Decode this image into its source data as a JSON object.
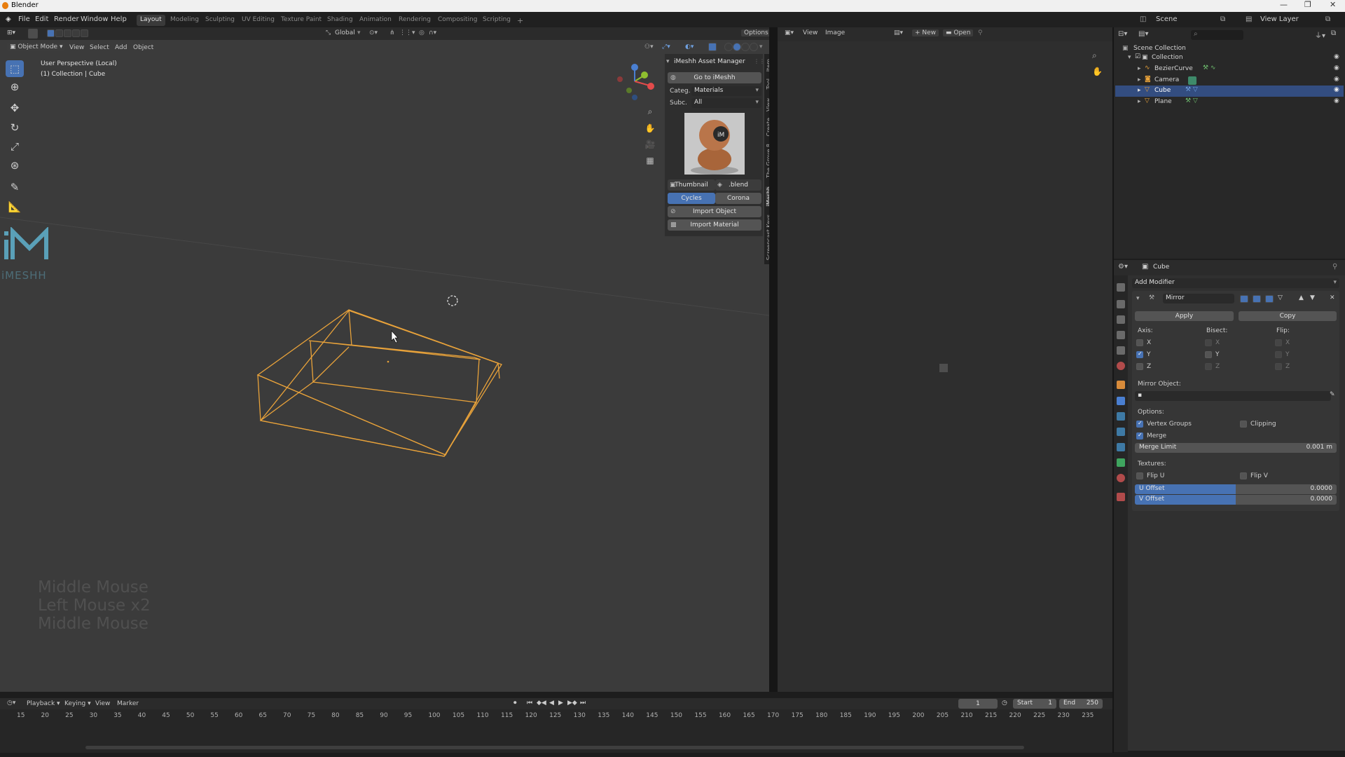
{
  "window": {
    "title": "Blender"
  },
  "menu": {
    "items": [
      "File",
      "Edit",
      "Render",
      "Window",
      "Help"
    ]
  },
  "workspaces": {
    "tabs": [
      "Layout",
      "Modeling",
      "Sculpting",
      "UV Editing",
      "Texture Paint",
      "Shading",
      "Animation",
      "Rendering",
      "Compositing",
      "Scripting"
    ],
    "active": "Layout",
    "add": "+"
  },
  "topright": {
    "scene": "Scene",
    "view_layer": "View Layer"
  },
  "viewport": {
    "mode": "Object Mode",
    "menus": [
      "View",
      "Select",
      "Add",
      "Object"
    ],
    "transform_orientation": "Global",
    "options_label": "Options",
    "overlay_line1": "User Perspective (Local)",
    "overlay_line2": "(1) Collection | Cube",
    "logo_text": "iMESHH",
    "screencast_keys": [
      "Middle Mouse",
      "Left Mouse x2",
      "Middle Mouse"
    ]
  },
  "npanel": {
    "title": "iMeshh Asset Manager",
    "goto_label": "Go to iMeshh",
    "category_label": "Categ.",
    "category_value": "Materials",
    "subcategory_label": "Subc.",
    "subcategory_value": "All",
    "thumbnail_label": "Thumbnail",
    "blend_label": ".blend",
    "render_engines": [
      "Cycles",
      "Corona"
    ],
    "active_engine": "Cycles",
    "import_object_label": "Import Object",
    "import_material_label": "Import Material",
    "side_tabs": [
      "Item",
      "Tool",
      "View",
      "Create",
      "The Grove 8",
      "iMeshh",
      "Screencast Keys"
    ]
  },
  "image_editor": {
    "menus": [
      "View",
      "Image"
    ],
    "new_label": "New",
    "open_label": "Open"
  },
  "outliner": {
    "root": "Scene Collection",
    "items": [
      {
        "label": "Collection",
        "level": 1,
        "selected": false
      },
      {
        "label": "BezierCurve",
        "level": 2,
        "selected": false
      },
      {
        "label": "Camera",
        "level": 2,
        "selected": false
      },
      {
        "label": "Cube",
        "level": 2,
        "selected": true
      },
      {
        "label": "Plane",
        "level": 2,
        "selected": false
      }
    ]
  },
  "properties": {
    "object_name": "Cube",
    "add_modifier_label": "Add Modifier",
    "modifier_name": "Mirror",
    "apply_label": "Apply",
    "copy_label": "Copy",
    "axis_label": "Axis:",
    "bisect_label": "Bisect:",
    "flip_label": "Flip:",
    "axes": [
      "X",
      "Y",
      "Z"
    ],
    "axis_checked": [
      false,
      true,
      false
    ],
    "mirror_object_label": "Mirror Object:",
    "options_label": "Options:",
    "vertex_groups_label": "Vertex Groups",
    "vertex_groups_checked": true,
    "clipping_label": "Clipping",
    "clipping_checked": false,
    "merge_label": "Merge",
    "merge_checked": true,
    "merge_limit_label": "Merge Limit",
    "merge_limit_value": "0.001 m",
    "textures_label": "Textures:",
    "flip_u_label": "Flip U",
    "flip_v_label": "Flip V",
    "u_offset_label": "U Offset",
    "u_offset_value": "0.0000",
    "v_offset_label": "V Offset",
    "v_offset_value": "0.0000"
  },
  "timeline": {
    "menus": [
      "Playback",
      "Keying",
      "View",
      "Marker"
    ],
    "current_frame": "1",
    "start_label": "Start",
    "start_value": "1",
    "end_label": "End",
    "end_value": "250",
    "ticks": [
      "15",
      "20",
      "25",
      "30",
      "35",
      "40",
      "45",
      "50",
      "55",
      "60",
      "65",
      "70",
      "75",
      "80",
      "85",
      "90",
      "95",
      "100",
      "105",
      "110",
      "115",
      "120",
      "125",
      "130",
      "135",
      "140",
      "145",
      "150",
      "155",
      "160",
      "165",
      "170",
      "175",
      "180",
      "185",
      "190",
      "195",
      "200",
      "205",
      "210",
      "215",
      "220",
      "225",
      "230",
      "235"
    ]
  },
  "colors": {
    "accent": "#4772b3",
    "selection_orange": "#e8a23a",
    "viewport_bg": "#3b3b3b"
  }
}
